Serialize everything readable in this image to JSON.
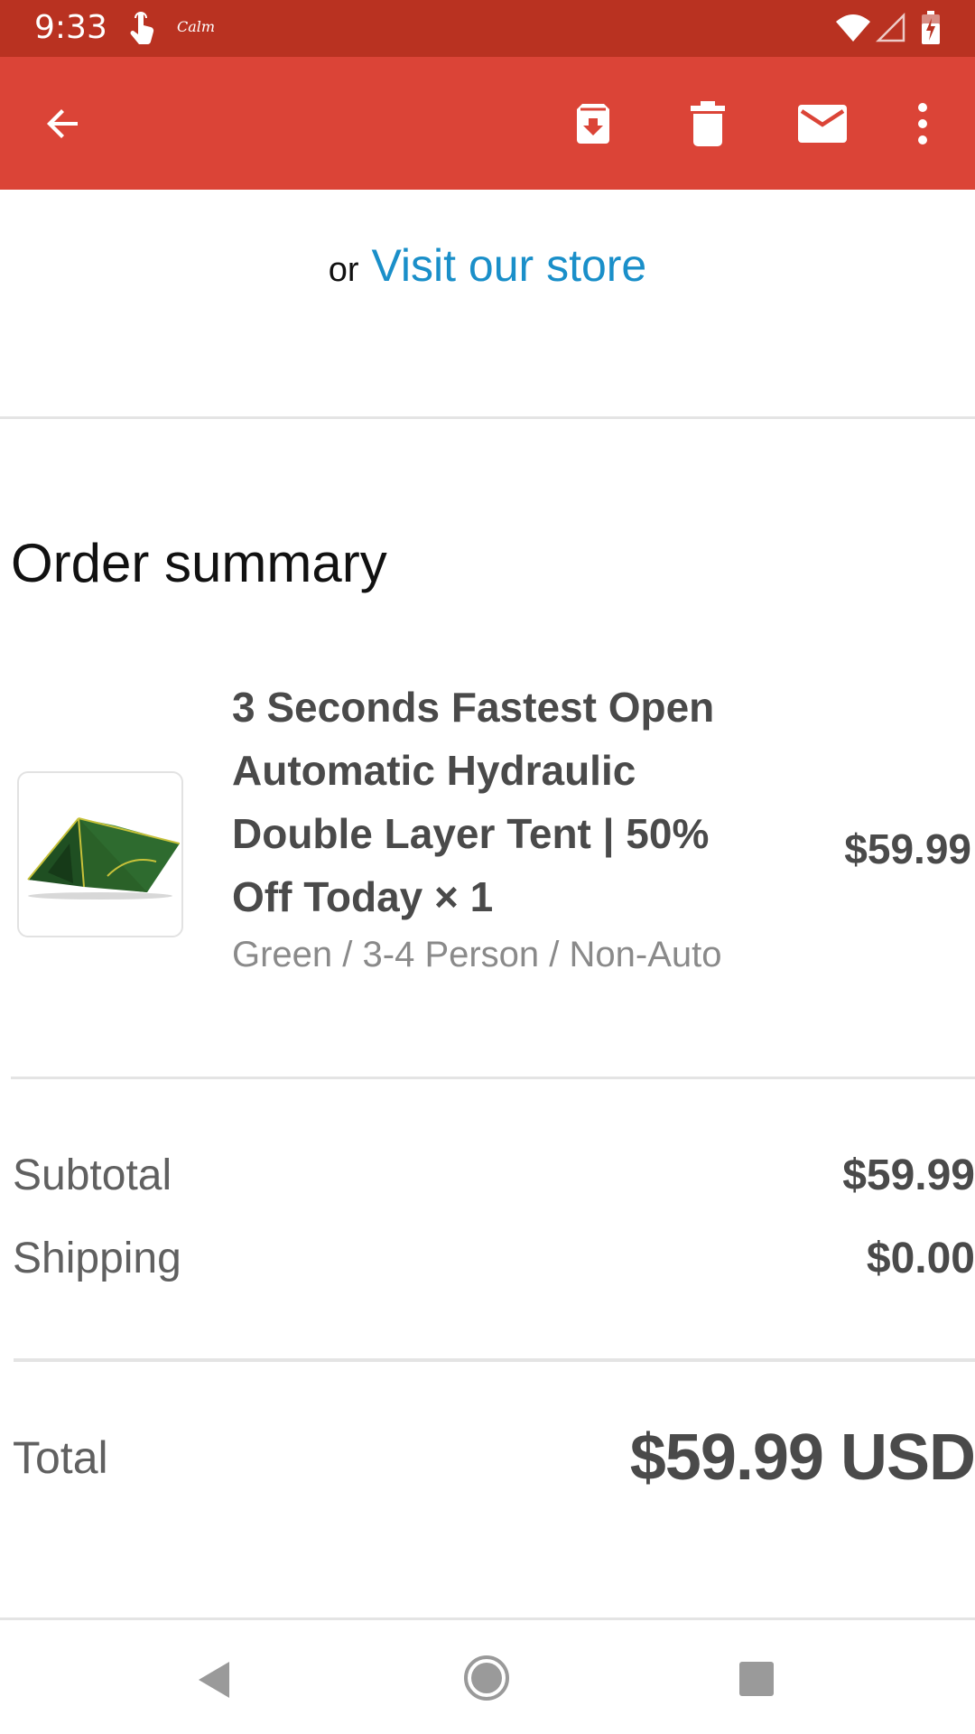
{
  "status_bar": {
    "time": "9:33",
    "notification_app": "Calm",
    "icons": [
      "touch-notification-icon",
      "wifi-icon",
      "cell-signal-icon",
      "battery-charging-icon"
    ]
  },
  "app_bar": {
    "actions": [
      "back-icon",
      "archive-icon",
      "delete-icon",
      "mark-unread-icon",
      "more-options-icon"
    ],
    "color": "#db4437"
  },
  "email": {
    "store_prefix": "or",
    "store_link": "Visit our store",
    "order_summary_title": "Order summary",
    "item": {
      "title": "3 Seconds Fastest Open Automatic Hydraulic Double Layer Tent | 50% Off Today × 1",
      "variant": "Green / 3-4 Person / Non-Auto",
      "price": "$59.99",
      "image": "green-tent-image"
    },
    "totals": {
      "subtotal_label": "Subtotal",
      "subtotal_value": "$59.99",
      "shipping_label": "Shipping",
      "shipping_value": "$0.00",
      "total_label": "Total",
      "total_value": "$59.99 USD"
    },
    "link_color": "#1a8fc9"
  },
  "nav_bar": {
    "buttons": [
      "nav-back-icon",
      "nav-home-icon",
      "nav-recents-icon"
    ]
  }
}
